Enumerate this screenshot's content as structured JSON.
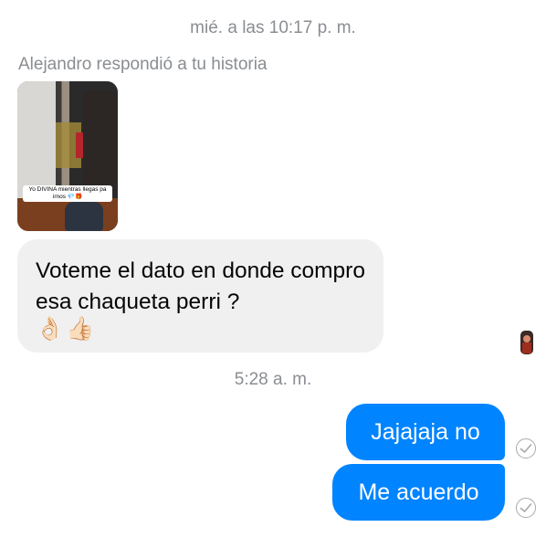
{
  "conversation": {
    "timestamp_1": "mié. a las 10:17 p. m.",
    "reply_label": "Alejandro respondió a tu historia",
    "story": {
      "caption": "Yo DIVINA mientras llegas pa irnos 💎🎁"
    },
    "incoming_message": {
      "text": "Voteme el dato en donde compro esa chaqueta perri ?",
      "emoji": "👌🏻👍🏻"
    },
    "timestamp_2": "5:28 a. m.",
    "outgoing_messages": [
      {
        "text": "Jajajaja no",
        "status_icon": "check-circle-icon"
      },
      {
        "text": "Me acuerdo",
        "status_icon": "check-circle-icon"
      }
    ]
  },
  "colors": {
    "outgoing_bubble": "#0084ff",
    "incoming_bubble": "#f0f0f0",
    "meta_text": "#8a8d91"
  }
}
